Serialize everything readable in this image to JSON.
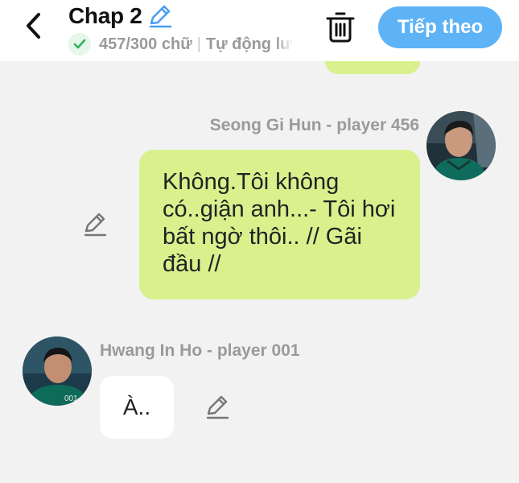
{
  "header": {
    "title": "Chap 2",
    "word_count": "457/300 chữ",
    "autosave_label": "Tự động lưu",
    "next_button_label": "Tiếp theo",
    "accent_color": "#5eb3f7",
    "icons": {
      "back": "chevron-left-icon",
      "title_edit": "pencil-icon",
      "status": "check-circle-icon",
      "delete": "trash-icon"
    }
  },
  "messages": [
    {
      "speaker": "Seong Gi Hun - player 456",
      "side": "right",
      "text": "Không.Tôi không có..giận anh...- Tôi hơi bất ngờ thôi.. // Gãi đầu //",
      "bubble_color": "#d8f18d"
    },
    {
      "speaker": "Hwang In Ho - player 001",
      "side": "left",
      "text": "À..",
      "bubble_color": "#ffffff"
    }
  ]
}
